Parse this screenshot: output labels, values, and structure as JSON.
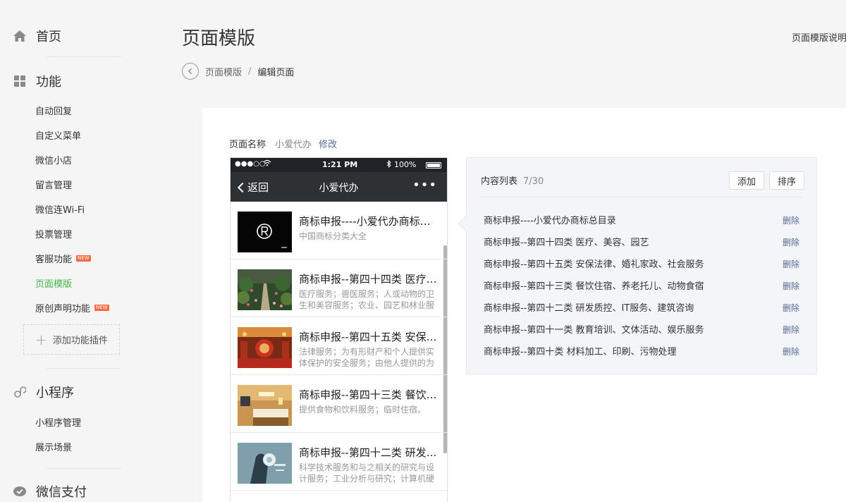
{
  "sidebar": {
    "home": {
      "label": "首页",
      "icon": "home-icon"
    },
    "features": {
      "label": "功能",
      "icon": "grid-icon",
      "items": [
        {
          "label": "自动回复"
        },
        {
          "label": "自定义菜单"
        },
        {
          "label": "微信小店"
        },
        {
          "label": "留言管理"
        },
        {
          "label": "微信连Wi-Fi"
        },
        {
          "label": "投票管理"
        },
        {
          "label": "客服功能",
          "badge": "NEW"
        },
        {
          "label": "页面模版",
          "active": true
        },
        {
          "label": "原创声明功能",
          "badge": "NEW"
        }
      ],
      "add_plugin": "添加功能插件"
    },
    "miniprogram": {
      "label": "小程序",
      "icon": "link-icon",
      "items": [
        {
          "label": "小程序管理"
        },
        {
          "label": "展示场景"
        }
      ]
    },
    "wechat_pay": {
      "label": "微信支付",
      "icon": "wechat-pay-icon"
    }
  },
  "header": {
    "title": "页面模版",
    "help": "页面模版说明"
  },
  "breadcrumb": {
    "parent": "页面模版",
    "separator": "/",
    "current": "编辑页面"
  },
  "page_name": {
    "label": "页面名称",
    "value": "小爱代办",
    "edit": "修改"
  },
  "phone": {
    "status": {
      "signal": "●●●○○",
      "time": "1:21 PM",
      "battery": "100%"
    },
    "back_label": "返回",
    "title": "小爱代办",
    "more": "•••",
    "articles": [
      {
        "title": "商标申报----小爱代办商标总目录",
        "desc": "中国商标分类大全"
      },
      {
        "title": "商标申报--第四十四类 医疗、美容、园艺",
        "desc": "医疗服务；兽医服务；人或动物的卫生和美容服务；农业、园艺和林业服务"
      },
      {
        "title": "商标申报--第四十五类 安保法律、婚礼家政、社会服务",
        "desc": "法律服务；为有形财产和个人提供实体保护的安全服务；由他人提供的为满足个人需要的私人和社会服务"
      },
      {
        "title": "商标申报--第四十三类 餐饮住宿、养老托儿、动物食宿",
        "desc": "提供食物和饮料服务；临时住宿。"
      },
      {
        "title": "商标申报--第四十二类 研发质控、IT服务、建筑咨询",
        "desc": "科学技术服务和与之相关的研究与设计服务；工业分析与研究；计算机硬件与软件的设计与开发"
      }
    ]
  },
  "content_list": {
    "title": "内容列表",
    "count": "7/30",
    "add_label": "添加",
    "sort_label": "排序",
    "delete_label": "删除",
    "items": [
      "商标申报----小爱代办商标总目录",
      "商标申报--第四十四类 医疗、美容、园艺",
      "商标申报--第四十五类 安保法律、婚礼家政、社会服务",
      "商标申报--第四十三类 餐饮住宿、养老托儿、动物食宿",
      "商标申报--第四十二类 研发质控、IT服务、建筑咨询",
      "商标申报--第四十一类 教育培训、文体活动、娱乐服务",
      "商标申报--第四十类 材料加工、印刷、污物处理"
    ]
  },
  "colors": {
    "accent": "#44b549",
    "link": "#576b95",
    "badge": "#fa6a41",
    "phone_header": "#2d3134"
  }
}
